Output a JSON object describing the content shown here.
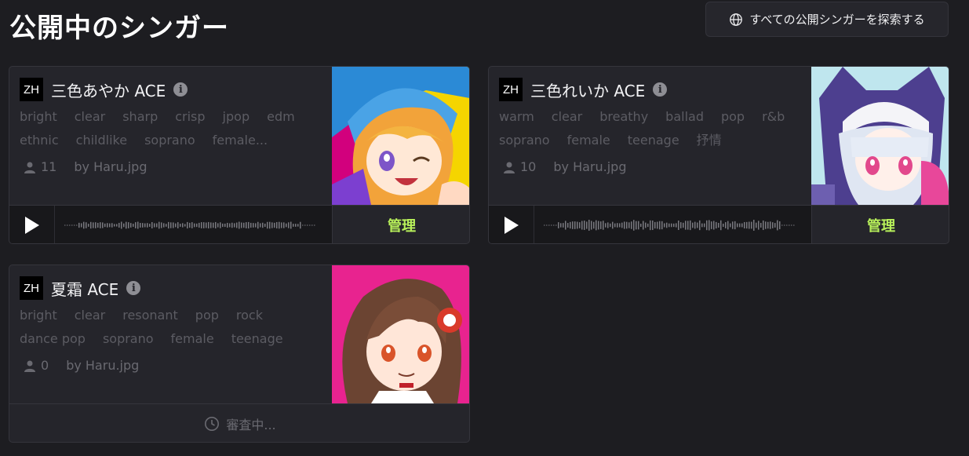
{
  "header": {
    "title": "公開中のシンガー",
    "explore_label": "すべての公開シンガーを探索する",
    "explore_icon": "globe-icon"
  },
  "colors": {
    "background": "#1d1d21",
    "card": "#25252b",
    "tag_text": "#5c5c63",
    "manage_accent": "#b8f15a"
  },
  "cards": [
    {
      "lang": "ZH",
      "name": "三色あやか ACE",
      "tags": [
        "bright",
        "clear",
        "sharp",
        "crisp",
        "jpop",
        "edm",
        "ethnic",
        "childlike",
        "soprano",
        "female..."
      ],
      "users": "11",
      "author": "by Haru.jpg",
      "action": "管理"
    },
    {
      "lang": "ZH",
      "name": "三色れいか ACE",
      "tags": [
        "warm",
        "clear",
        "breathy",
        "ballad",
        "pop",
        "r&b",
        "soprano",
        "female",
        "teenage",
        "抒情"
      ],
      "users": "10",
      "author": "by Haru.jpg",
      "action": "管理"
    },
    {
      "lang": "ZH",
      "name": "夏霜 ACE",
      "tags": [
        "bright",
        "clear",
        "resonant",
        "pop",
        "rock",
        "dance pop",
        "soprano",
        "female",
        "teenage"
      ],
      "users": "0",
      "author": "by Haru.jpg",
      "status": "審査中..."
    }
  ]
}
